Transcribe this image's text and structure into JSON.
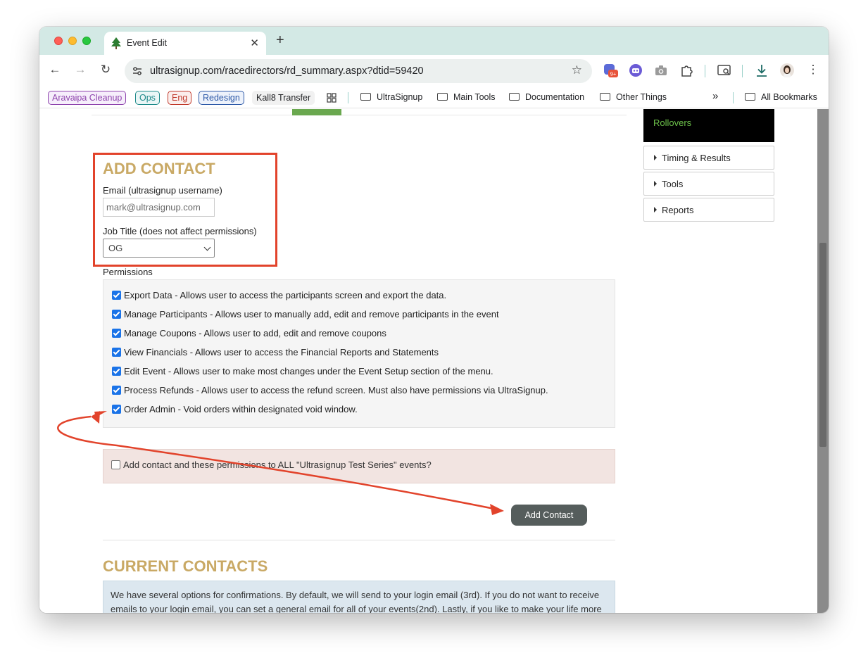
{
  "browser": {
    "tab_title": "Event Edit",
    "tab_close": "✕",
    "new_tab": "+",
    "url": "ultrasignup.com/racedirectors/rd_summary.aspx?dtid=59420",
    "nav": {
      "back": "←",
      "forward": "→",
      "reload": "↻"
    },
    "star": "☆",
    "menu": "⋮",
    "extension_badge": "9+",
    "more_bookmarks": "»",
    "bookmarks": {
      "chips": [
        {
          "label": "Aravaipa Cleanup",
          "color": "#8e44ad"
        },
        {
          "label": "Ops",
          "color": "#1e8a8a"
        },
        {
          "label": "Eng",
          "color": "#c0392b"
        },
        {
          "label": "Redesign",
          "color": "#2e5aa8"
        }
      ],
      "plain": "Kall8 Transfer",
      "folders": [
        "UltraSignup",
        "Main Tools",
        "Documentation",
        "Other Things"
      ],
      "all": "All Bookmarks"
    }
  },
  "sidebar": {
    "active": "Rollovers",
    "items": [
      "Timing & Results",
      "Tools",
      "Reports"
    ]
  },
  "add_contact": {
    "title": "ADD CONTACT",
    "email_label": "Email (ultrasignup username)",
    "email_value": "mark@ultrasignup.com",
    "job_title_label": "Job Title (does not affect permissions)",
    "job_title_value": "OG",
    "permissions_label": "Permissions",
    "permissions": [
      {
        "text": "Export Data - Allows user to access the participants screen and export the data.",
        "checked": true
      },
      {
        "text": "Manage Participants - Allows user to manually add, edit and remove participants in the event",
        "checked": true
      },
      {
        "text": "Manage Coupons - Allows user to add, edit and remove coupons",
        "checked": true
      },
      {
        "text": "View Financials - Allows user to access the Financial Reports and Statements",
        "checked": true
      },
      {
        "text": "Edit Event - Allows user to make most changes under the Event Setup section of the menu.",
        "checked": true
      },
      {
        "text": "Process Refunds - Allows user to access the refund screen. Must also have permissions via UltraSignup.",
        "checked": true
      },
      {
        "text": "Order Admin - Void orders within designated void window.",
        "checked": true
      }
    ],
    "series_option": {
      "text": "Add contact and these permissions to ALL \"Ultrasignup Test Series\" events?",
      "checked": false
    },
    "submit_label": "Add Contact"
  },
  "current_contacts": {
    "title": "CURRENT CONTACTS",
    "info": "We have several options for confirmations. By default, we will send to your login email (3rd). If you do not want to receive emails to your login email, you can set a general email for all of your events(2nd). Lastly, if you like to make your life more complicated, you can specify a specific email per event(1st). Also, your registration page has an \"Ask a question?\" button on it. If someone sends a message via that button, an email will be sent to all those with a check in the \"Receive"
  },
  "colors": {
    "heading_gold": "#c9a965",
    "annotation_red": "#e2432b",
    "sidebar_green": "#6cc04a",
    "button_dark": "#555d5c"
  }
}
